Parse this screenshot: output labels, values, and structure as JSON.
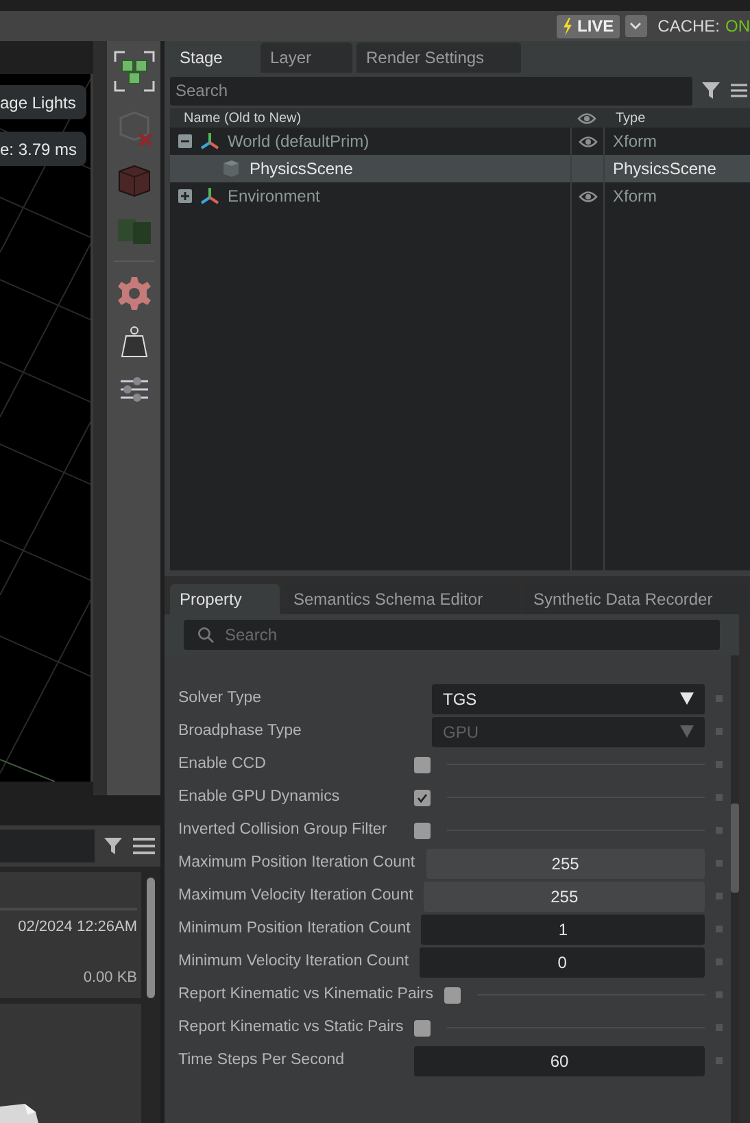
{
  "top_bar": {
    "live_label": "LIVE",
    "cache_label": "CACHE:",
    "cache_value": "ON"
  },
  "viewport": {
    "overlay_buttons": [
      "age Lights",
      "e: 3.79 ms"
    ]
  },
  "content_browser": {
    "items": [
      {
        "date": "02/2024 12:26AM",
        "size": "0.00 KB"
      }
    ]
  },
  "stage": {
    "tabs": [
      {
        "label": "Stage",
        "selected": true
      },
      {
        "label": "Layer",
        "selected": false
      },
      {
        "label": "Render Settings",
        "selected": false
      }
    ],
    "search": {
      "placeholder": "Search"
    },
    "columns": {
      "name": "Name (Old to New)",
      "type": "Type"
    },
    "tree": [
      {
        "name": "World (defaultPrim)",
        "type": "Xform",
        "visible": true,
        "expanded": true,
        "selected": false,
        "children": [
          {
            "name": "PhysicsScene",
            "type": "PhysicsScene",
            "visible": false,
            "selected": true
          }
        ]
      },
      {
        "name": "Environment",
        "type": "Xform",
        "visible": true,
        "expanded": false,
        "selected": false
      }
    ]
  },
  "property": {
    "tabs": [
      {
        "label": "Property",
        "selected": true
      },
      {
        "label": "Semantics Schema Editor",
        "selected": false
      },
      {
        "label": "Synthetic Data Recorder",
        "selected": false
      }
    ],
    "search": {
      "placeholder": "Search"
    },
    "rows": [
      {
        "kind": "dropdown",
        "label": "Solver Type",
        "value": "TGS",
        "disabled": false
      },
      {
        "kind": "dropdown",
        "label": "Broadphase Type",
        "value": "GPU",
        "disabled": true
      },
      {
        "kind": "checkbox",
        "label": "Enable CCD",
        "checked": false
      },
      {
        "kind": "checkbox",
        "label": "Enable GPU Dynamics",
        "checked": true
      },
      {
        "kind": "checkbox",
        "label": "Inverted Collision Group Filter",
        "checked": false
      },
      {
        "kind": "drag",
        "label": "Maximum Position Iteration Count",
        "value": "255"
      },
      {
        "kind": "drag",
        "label": "Maximum Velocity Iteration Count",
        "value": "255"
      },
      {
        "kind": "int",
        "label": "Minimum Position Iteration Count",
        "value": "1"
      },
      {
        "kind": "int",
        "label": "Minimum Velocity Iteration Count",
        "value": "0"
      },
      {
        "kind": "checkbox",
        "label": "Report Kinematic vs Kinematic Pairs",
        "checked": false
      },
      {
        "kind": "checkbox",
        "label": "Report Kinematic vs Static Pairs",
        "checked": false
      },
      {
        "kind": "int",
        "label": "Time Steps Per Second",
        "value": "60"
      }
    ]
  }
}
